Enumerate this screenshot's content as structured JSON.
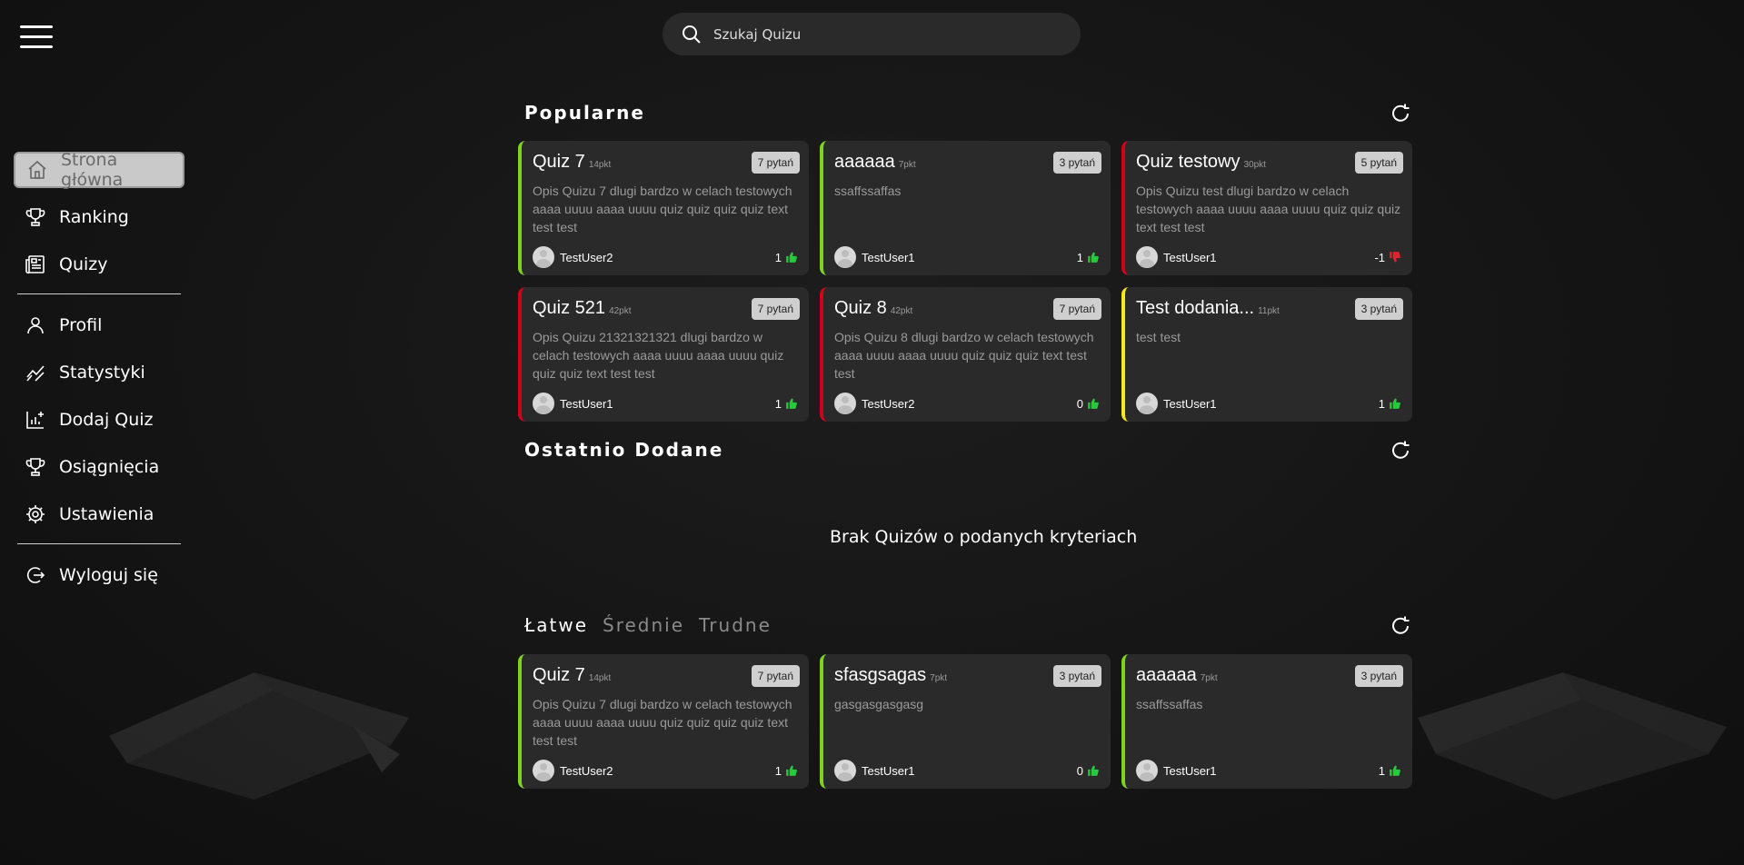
{
  "search": {
    "placeholder": "Szukaj Quizu"
  },
  "sidebar": {
    "items": [
      {
        "label": "Strona główna",
        "icon": "home-icon",
        "active": true
      },
      {
        "label": "Ranking",
        "icon": "trophy-icon"
      },
      {
        "label": "Quizy",
        "icon": "newspaper-icon"
      },
      {
        "label": "Profil",
        "icon": "user-icon"
      },
      {
        "label": "Statystyki",
        "icon": "chart-line-icon"
      },
      {
        "label": "Dodaj Quiz",
        "icon": "chart-add-icon"
      },
      {
        "label": "Osiągnięcia",
        "icon": "trophy-icon"
      },
      {
        "label": "Ustawienia",
        "icon": "gear-icon"
      },
      {
        "label": "Wyloguj się",
        "icon": "logout-icon"
      }
    ]
  },
  "sections": {
    "popular": {
      "title": "Popularne",
      "cards": [
        {
          "title": "Quiz 7",
          "points": "14pkt",
          "questions": "7 pytań",
          "desc": "Opis Quizu 7 dlugi bardzo w celach testowych aaaa uuuu aaaa uuuu quiz quiz quiz quiz text test test",
          "author": "TestUser2",
          "votes": "1",
          "vote_type": "up",
          "color": "green"
        },
        {
          "title": "aaaaaa",
          "points": "7pkt",
          "questions": "3 pytań",
          "desc": "ssaffssaffas",
          "author": "TestUser1",
          "votes": "1",
          "vote_type": "up",
          "color": "green"
        },
        {
          "title": "Quiz testowy",
          "points": "30pkt",
          "questions": "5 pytań",
          "desc": "Opis Quizu test dlugi bardzo w celach testowych aaaa uuuu aaaa uuuu quiz quiz quiz text test test",
          "author": "TestUser1",
          "votes": "-1",
          "vote_type": "down",
          "color": "red"
        },
        {
          "title": "Quiz 521",
          "points": "42pkt",
          "questions": "7 pytań",
          "desc": "Opis Quizu 21321321321 dlugi bardzo w celach testowych aaaa uuuu aaaa uuuu quiz quiz quiz text test test",
          "author": "TestUser1",
          "votes": "1",
          "vote_type": "up",
          "color": "red"
        },
        {
          "title": "Quiz 8",
          "points": "42pkt",
          "questions": "7 pytań",
          "desc": "Opis Quizu 8 dlugi bardzo w celach testowych aaaa uuuu aaaa uuuu quiz quiz quiz text test test",
          "author": "TestUser2",
          "votes": "0",
          "vote_type": "up",
          "color": "red"
        },
        {
          "title": "Test dodania...",
          "points": "11pkt",
          "questions": "3 pytań",
          "desc": "test test",
          "author": "TestUser1",
          "votes": "1",
          "vote_type": "up",
          "color": "yellow"
        }
      ]
    },
    "recent": {
      "title": "Ostatnio Dodane",
      "empty_message": "Brak Quizów o podanych kryteriach"
    },
    "difficulty": {
      "tabs": [
        "Łatwe",
        "Średnie",
        "Trudne"
      ],
      "active_tab": 0,
      "cards": [
        {
          "title": "Quiz 7",
          "points": "14pkt",
          "questions": "7 pytań",
          "desc": "Opis Quizu 7 dlugi bardzo w celach testowych aaaa uuuu aaaa uuuu quiz quiz quiz quiz text test test",
          "author": "TestUser2",
          "votes": "1",
          "vote_type": "up",
          "color": "green"
        },
        {
          "title": "sfasgsagas",
          "points": "7pkt",
          "questions": "3 pytań",
          "desc": "gasgasgasgasg",
          "author": "TestUser1",
          "votes": "0",
          "vote_type": "up",
          "color": "green"
        },
        {
          "title": "aaaaaa",
          "points": "7pkt",
          "questions": "3 pytań",
          "desc": "ssaffssaffas",
          "author": "TestUser1",
          "votes": "1",
          "vote_type": "up",
          "color": "green"
        }
      ]
    }
  },
  "colors": {
    "green": "#7ed321",
    "red": "#d0021b",
    "yellow": "#f8e71c",
    "thumb_up": "#27c93f",
    "thumb_down": "#e0242f"
  }
}
